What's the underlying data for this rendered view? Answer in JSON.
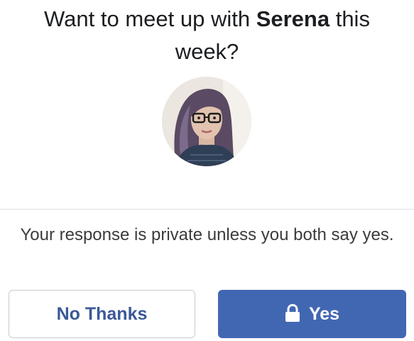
{
  "prompt": {
    "text_before": "Want to meet up with ",
    "name": "Serena",
    "text_after": " this week?"
  },
  "avatar": {
    "alt": "Serena profile photo"
  },
  "privacy_note": "Your response is private unless you both say yes.",
  "buttons": {
    "decline_label": "No Thanks",
    "accept_label": "Yes",
    "accept_icon": "lock-icon"
  },
  "colors": {
    "accept_background": "#4267b2",
    "decline_text": "#3b5998",
    "divider": "#dddfe2"
  }
}
